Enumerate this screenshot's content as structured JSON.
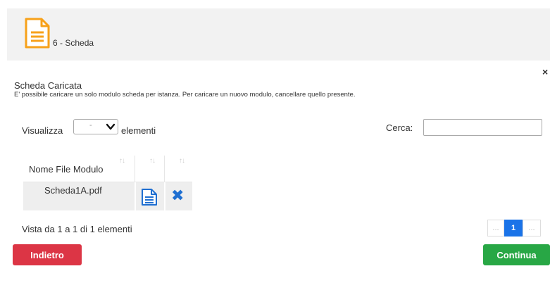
{
  "header": {
    "title": "6 - Scheda",
    "icon": "document-icon",
    "icon_color": "#f7a11a"
  },
  "dialog": {
    "close": "×",
    "section_title": "Scheda Caricata",
    "section_desc": "E' possibile caricare un solo modulo scheda per istanza. Per caricare un nuovo modulo, cancellare quello presente."
  },
  "table_controls": {
    "show_prefix": "Visualizza",
    "show_value": "-",
    "show_suffix": "elementi",
    "search_label": "Cerca:",
    "search_value": ""
  },
  "table": {
    "columns": [
      "Nome File Modulo",
      "",
      ""
    ],
    "sort_glyph": "↑↓",
    "rows": [
      {
        "file_name": "Scheda1A.pdf",
        "view_icon": "document-icon",
        "delete_icon": "close-icon"
      }
    ]
  },
  "footer": {
    "info": "Vista da 1 a 1 di 1 elementi",
    "pagination": {
      "prev": "...",
      "current": "1",
      "next": "..."
    }
  },
  "actions": {
    "back_label": "Indietro",
    "continue_label": "Continua",
    "back_color": "#dc3545",
    "continue_color": "#28a745",
    "accent_color": "#1a73e8"
  }
}
